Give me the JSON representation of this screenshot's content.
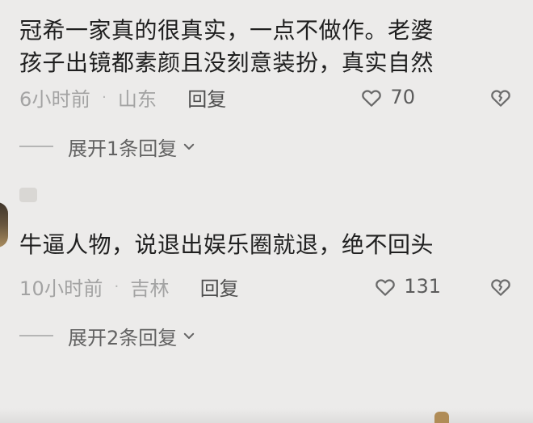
{
  "comments": [
    {
      "text": "冠希一家真的很真实，一点不做作。老婆\n孩子出镜都素颜且没刻意装扮，真实自然",
      "time": "6小时前",
      "location": "山东",
      "reply_label": "回复",
      "likes": "70",
      "expand_label": "展开1条回复"
    },
    {
      "text": "牛逼人物，说退出娱乐圈就退，绝不回头",
      "time": "10小时前",
      "location": "吉林",
      "reply_label": "回复",
      "likes": "131",
      "expand_label": "展开2条回复"
    }
  ],
  "meta": {
    "separator": "·"
  },
  "icons": {
    "like": "heart-icon",
    "dislike": "broken-heart-icon",
    "expand": "chevron-down-icon",
    "avatar": "avatar"
  }
}
